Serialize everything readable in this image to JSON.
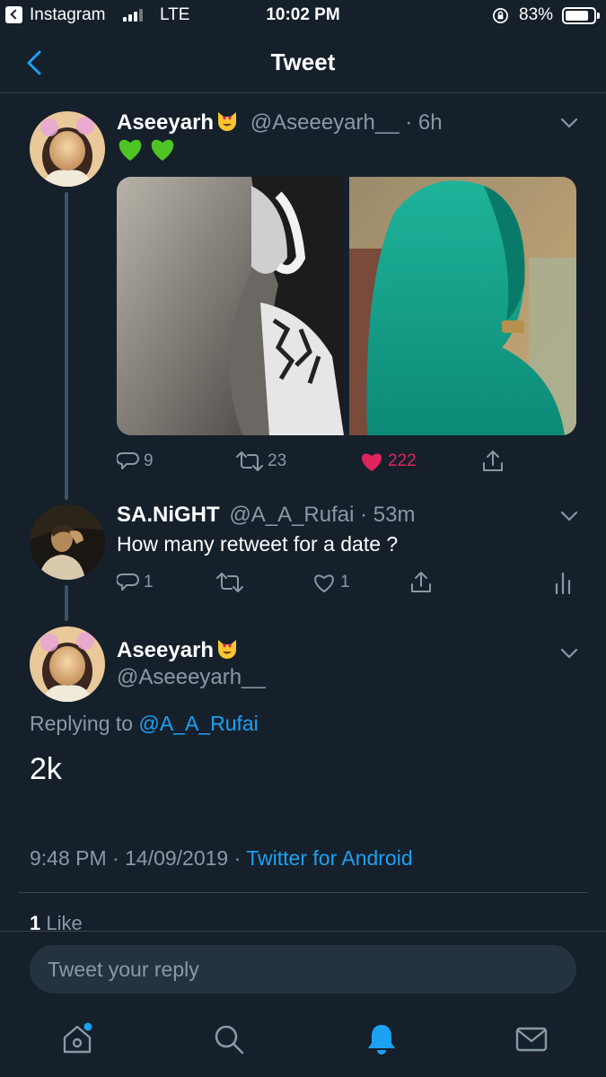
{
  "status_bar": {
    "back_app": "Instagram",
    "network": "LTE",
    "time": "10:02 PM",
    "battery": "83%",
    "battery_level": 0.83
  },
  "header": {
    "title": "Tweet"
  },
  "tweet1": {
    "name": "Aseeyarh",
    "name_emoji": "heart-eyes-cat-emoji",
    "handle_time": "@Aseeeyarh__ · 6h",
    "text_emojis": [
      "green-heart-emoji",
      "green-heart-emoji"
    ],
    "actions": {
      "replies": "9",
      "retweets": "23",
      "likes": "222"
    }
  },
  "tweet2": {
    "name": "SA.NiGHT",
    "handle_time": "@A_A_Rufai · 53m",
    "text": "How many retweet for a date ?",
    "actions": {
      "replies": "1",
      "retweets": "",
      "likes": "1"
    }
  },
  "main_tweet": {
    "name": "Aseeyarh",
    "handle": "@Aseeeyarh__",
    "replying_label": "Replying to",
    "replying_to": "@A_A_Rufai",
    "text": "2k",
    "time": "9:48 PM",
    "date": "14/09/2019",
    "source": "Twitter for Android",
    "likes_count": "1",
    "likes_label": "Like"
  },
  "reply_bar": {
    "placeholder": "Tweet your reply"
  },
  "tabbar": {
    "icons": [
      "home-icon",
      "search-icon",
      "notifications-icon",
      "messages-icon"
    ],
    "active": "notifications-icon"
  },
  "colors": {
    "background": "#15202b",
    "accent": "#1da1f2",
    "like": "#e0245e",
    "secondary": "#8899a6"
  }
}
